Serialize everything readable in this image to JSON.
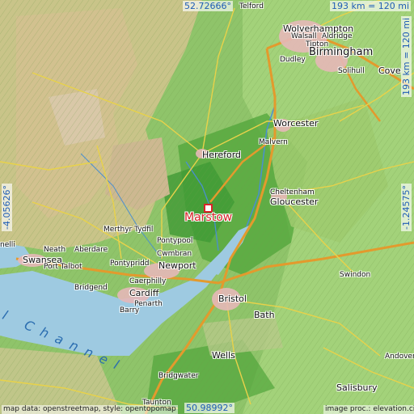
{
  "coordinates": {
    "north": "52.72666°",
    "south": "50.98992°",
    "west": "-4.05626°",
    "east": "-1.24575°"
  },
  "scale": {
    "top": "193 km = 120 mi",
    "right": "193 km = 120 mi"
  },
  "marker": {
    "label": "Marstow"
  },
  "places": {
    "telford": "Telford",
    "wolverhampton": "Wolverhampton",
    "walsall": "Walsall",
    "aldridge": "Aldridge",
    "tipton": "Tipton",
    "birmingham": "Birmingham",
    "dudley": "Dudley",
    "solihull": "Solihull",
    "coventry": "Cove",
    "worcester": "Worcester",
    "malvern": "Malvern",
    "hereford": "Hereford",
    "cheltenham": "Cheltenham",
    "gloucester": "Gloucester",
    "merthyr": "Merthyr Tydfil",
    "pontypool": "Pontypool",
    "cwmbran": "Cwmbran",
    "newport": "Newport",
    "neath": "Neath",
    "aberdare": "Aberdare",
    "swansea": "Swansea",
    "porttalbot": "Port Talbot",
    "pontypridd": "Pontypridd",
    "caerphilly": "Caerphilly",
    "cardiff": "Cardiff",
    "bridgend": "Bridgend",
    "penarth": "Penarth",
    "barry": "Barry",
    "bristol": "Bristol",
    "swindon": "Swindon",
    "bath": "Bath",
    "wells": "Wells",
    "bridgwater": "Bridgwater",
    "taunton": "Taunton",
    "salisbury": "Salisbury",
    "andover": "Andover",
    "llanelli": "nelli",
    "channel": "l Channel"
  },
  "attribution": {
    "left": "map data: openstreetmap, style: opentopomap",
    "right": "image proc.: elevation.city"
  },
  "colors": {
    "sea": "#9ecae1",
    "lowland": "#8fc46a",
    "marker": "#d8232a",
    "coord_text": "#1f5db5"
  }
}
